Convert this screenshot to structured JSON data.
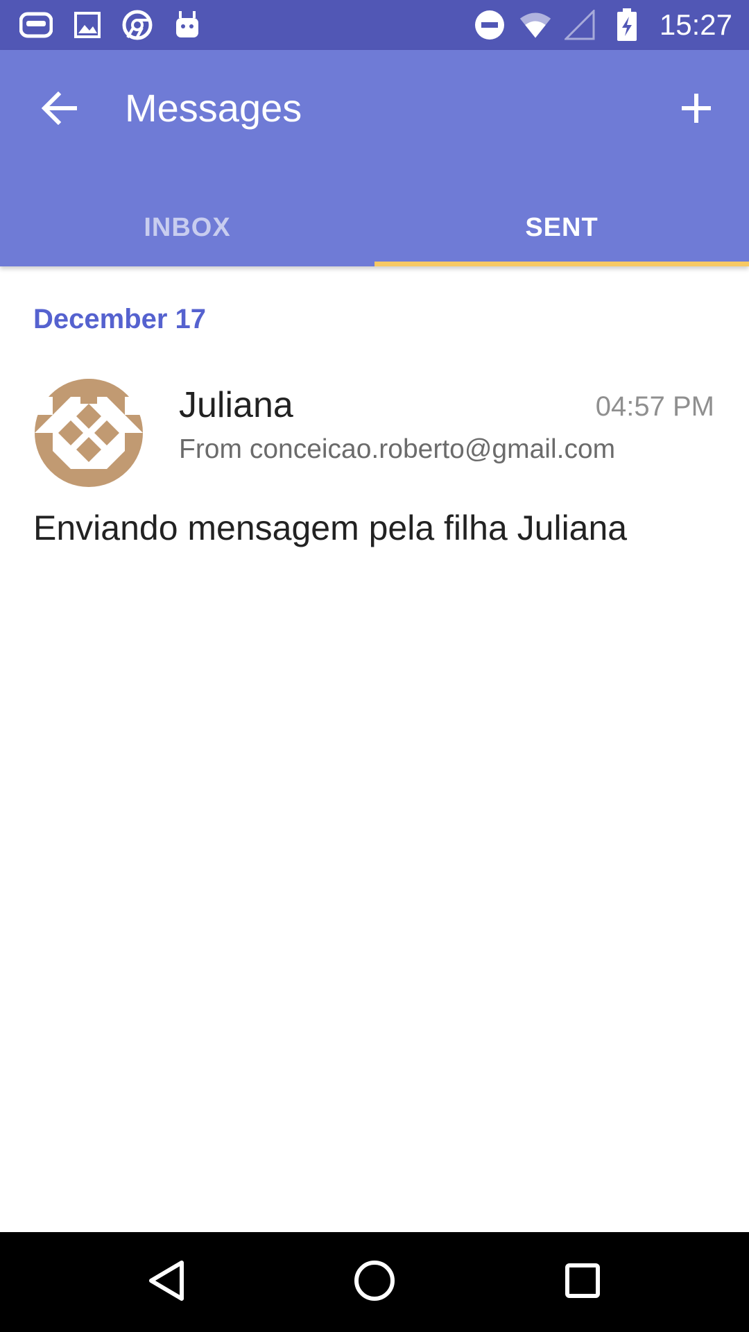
{
  "status_bar": {
    "time": "15:27",
    "icons": [
      "gamepad-icon",
      "image-icon",
      "chrome-icon",
      "android-icon",
      "dnd-icon",
      "wifi-icon",
      "signal-icon",
      "battery-charging-icon"
    ]
  },
  "app_bar": {
    "title": "Messages",
    "back_icon": "arrow-back-icon",
    "add_icon": "plus-icon",
    "color": "#6f7bd6"
  },
  "tabs": [
    {
      "label": "INBOX",
      "active": false
    },
    {
      "label": "SENT",
      "active": true
    }
  ],
  "accent_colors": {
    "tab_indicator": "#f7c964",
    "date_header": "#5562cf",
    "avatar": "#c19a72"
  },
  "messages": {
    "date_header": "December 17",
    "items": [
      {
        "sender": "Juliana",
        "time": "04:57 PM",
        "from": "From conceicao.roberto@gmail.com",
        "body": "Enviando mensagem pela filha Juliana"
      }
    ]
  },
  "nav_bar": {
    "icons": [
      "back-triangle-icon",
      "home-circle-icon",
      "recents-square-icon"
    ]
  }
}
